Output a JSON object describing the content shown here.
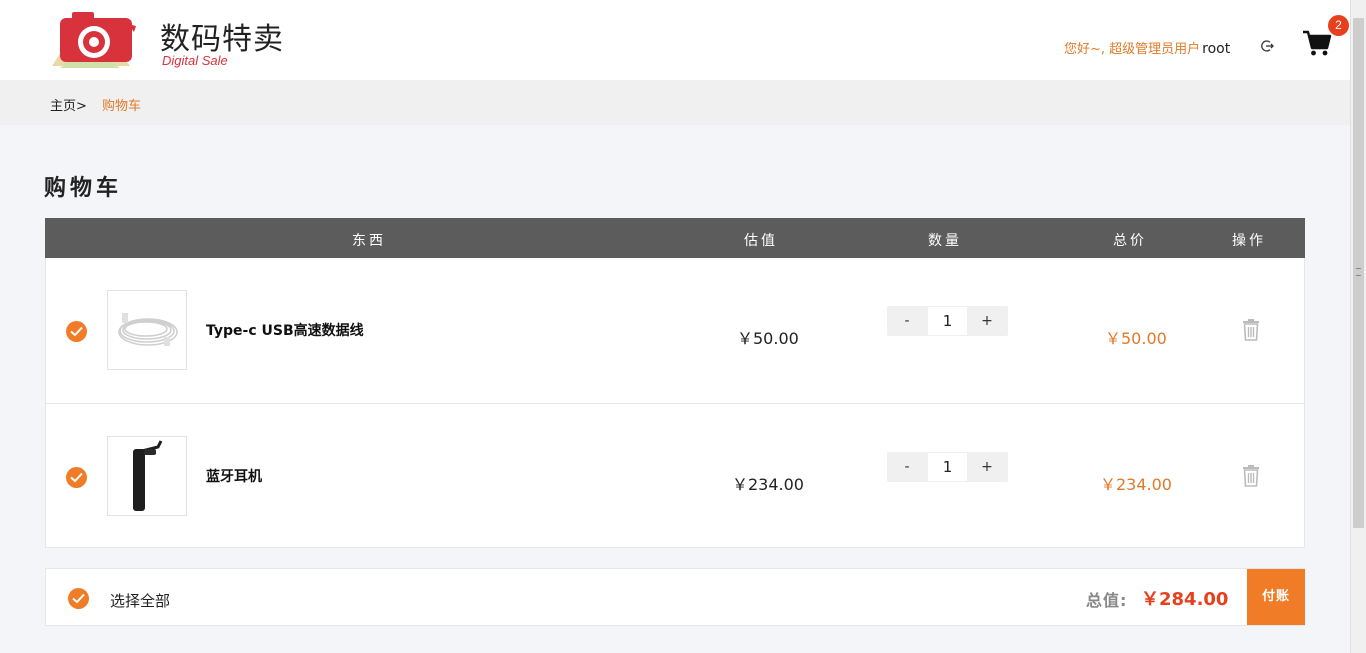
{
  "header": {
    "logo_cn": "数码特卖",
    "logo_en": "Digital Sale",
    "greeting": "您好~, 超级管理员用户",
    "username": "root",
    "cart_count": "2",
    "accent_color": "#e07a2a"
  },
  "breadcrumb": {
    "home": "主页>",
    "current": "购物车"
  },
  "page_title": "购物车",
  "table": {
    "columns": [
      "东西",
      "估值",
      "数量",
      "总价",
      "操作"
    ],
    "rows": [
      {
        "name": "Type-c USB高速数据线",
        "price": "￥50.00",
        "qty_minus": "-",
        "qty": "1",
        "qty_plus": "+",
        "subtotal": "￥50.00",
        "checked": true
      },
      {
        "name": "蓝牙耳机",
        "price": "￥234.00",
        "qty_minus": "-",
        "qty": "1",
        "qty_plus": "+",
        "subtotal": "￥234.00",
        "checked": true
      }
    ]
  },
  "footer": {
    "select_all": "选择全部",
    "total_label": "总值:",
    "total_value": "￥284.00",
    "pay_button": "付账"
  },
  "icons": [
    "logo-camera-icon",
    "logout-icon",
    "cart-icon",
    "check-icon",
    "trash-icon"
  ],
  "colors": {
    "orange": "#f07c28",
    "red": "#e8401c",
    "header_dark": "#5c5c5c"
  }
}
